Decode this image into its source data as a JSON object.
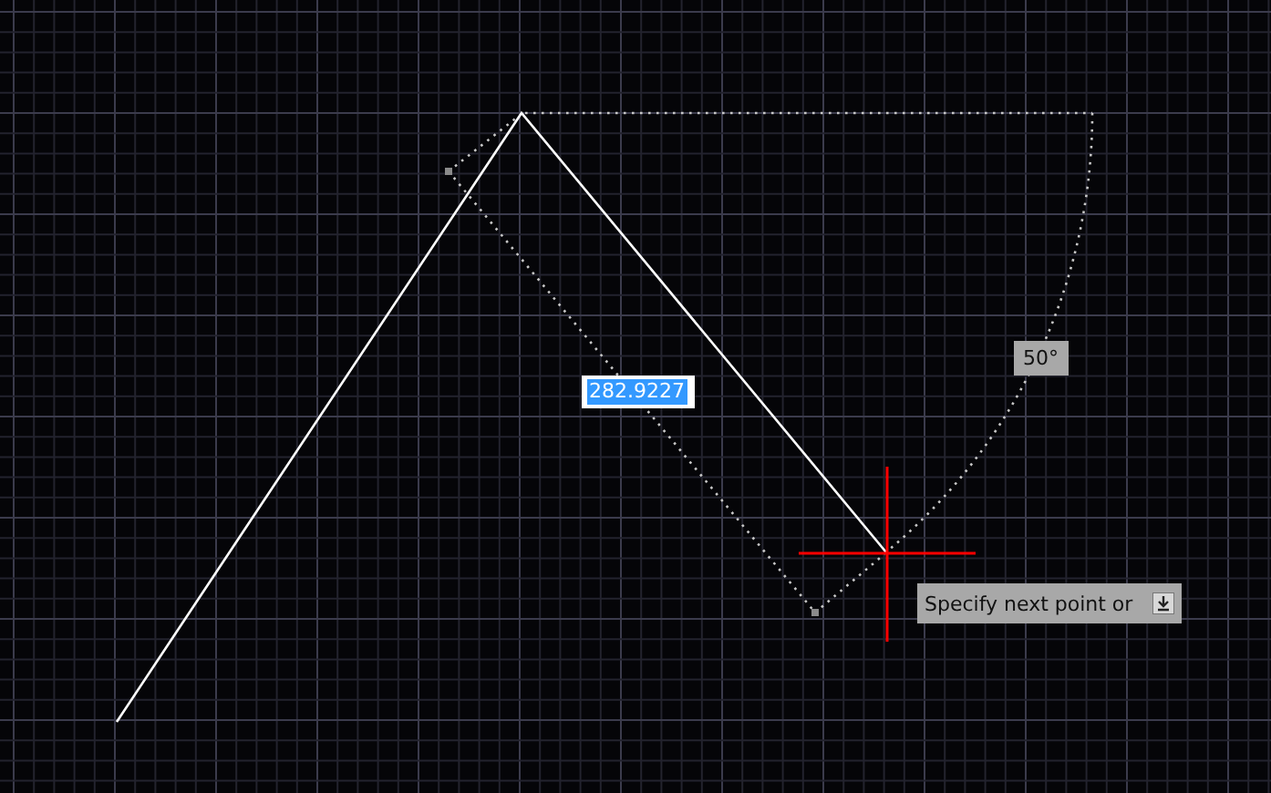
{
  "dimension_input": {
    "value": "282.9227",
    "selected": true
  },
  "angle_label": {
    "text": "50°"
  },
  "tooltip": {
    "text": "Specify next point or"
  }
}
